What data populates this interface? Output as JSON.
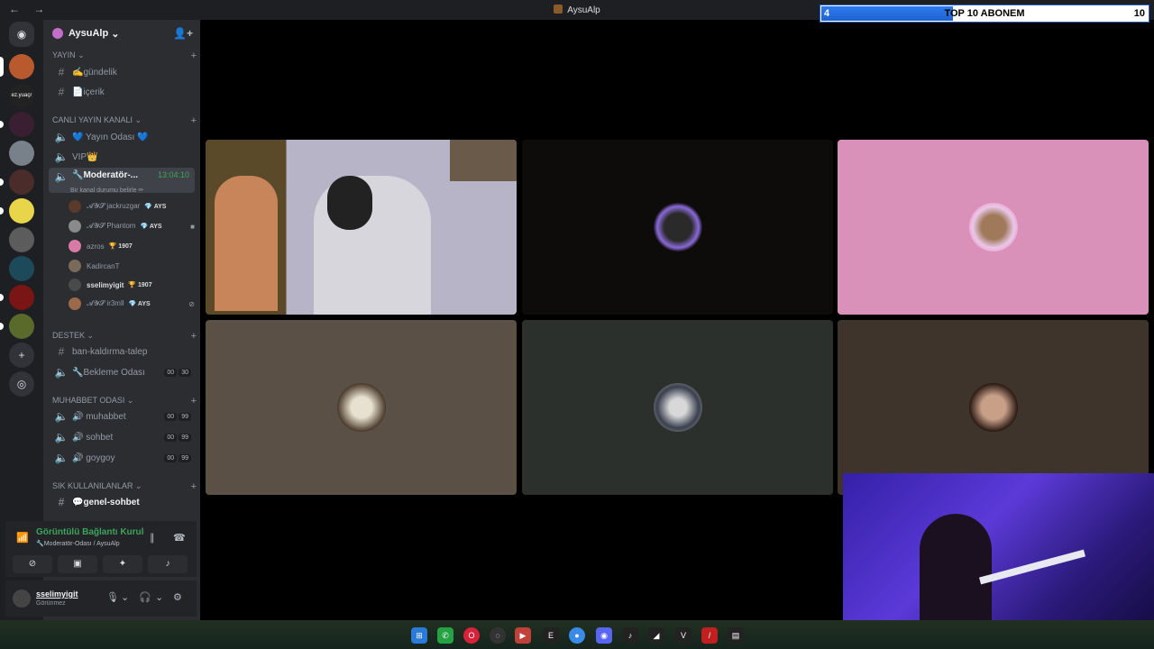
{
  "window": {
    "title": "AysuAlp",
    "nav": "← →"
  },
  "sub_goal": {
    "current": "4",
    "label": "TOP 10 ABONEM",
    "goal": "10",
    "progress": 0.4
  },
  "server": {
    "name": "AysuAlp"
  },
  "categories": {
    "yayin": "YAYIN",
    "canli": "CANLI YAYIN KANALI",
    "destek": "DESTEK",
    "muhabbet": "MUHABBET ODASI",
    "sik": "SIK KULLANILANLAR"
  },
  "channels": {
    "gundelik": "✍️gündelik",
    "icerik": "📄içerik",
    "yayin_odasi": "💙 Yayın Odası 💙",
    "vip": "VIP👑",
    "moderator": "🔧Moderatör-...",
    "moderator_time": "13:04:10",
    "moderator_status": "Bir kanal durumu belirle ✏",
    "ban": "ban-kaldırma-talep",
    "bekleme": "🔧Bekleme Odası",
    "bekleme_counts": [
      "00",
      "30"
    ],
    "muhabbet": "🔊 muhabbet",
    "muhabbet_counts": [
      "00",
      "99"
    ],
    "sohbet": "🔊 sohbet",
    "sohbet_counts": [
      "00",
      "99"
    ],
    "goygoy": "🔊 goygoy",
    "goygoy_counts": [
      "00",
      "99"
    ],
    "genel": "💬genel-sohbet"
  },
  "voice_users": [
    {
      "name": "𝓐𝓨𝓢 jackruzgar",
      "tag": "💎 AYS"
    },
    {
      "name": "𝓐𝓨𝓢 Phantom",
      "tag": "💎 AYS"
    },
    {
      "name": "azros",
      "tag": "🏆 1907"
    },
    {
      "name": "KadircanT",
      "tag": ""
    },
    {
      "name": "sselimyigit",
      "tag": "🏆 1907"
    },
    {
      "name": "𝓐𝓨𝓢 ir3mll",
      "tag": "💎 AYS"
    }
  ],
  "voice_panel": {
    "status": "Görüntülü Bağlantı Kuruldu",
    "location": "🔧Moderatör-Odası / AysuAlp"
  },
  "user_panel": {
    "name": "sselimyigit",
    "status": "Görünmez"
  }
}
